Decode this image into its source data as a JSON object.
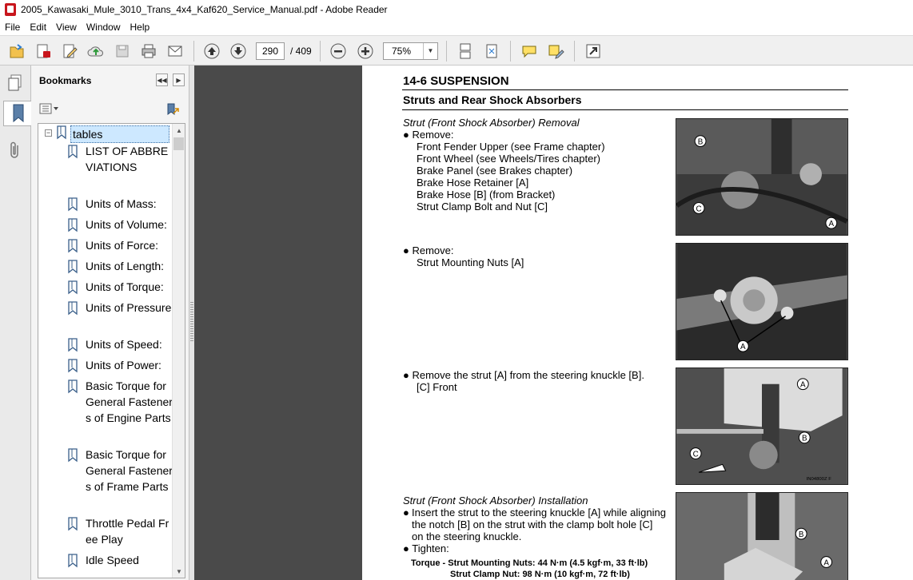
{
  "window": {
    "title": "2005_Kawasaki_Mule_3010_Trans_4x4_Kaf620_Service_Manual.pdf - Adobe Reader"
  },
  "menu": [
    "File",
    "Edit",
    "View",
    "Window",
    "Help"
  ],
  "toolbar": {
    "page_current": "290",
    "page_total": "/ 409",
    "zoom": "75%"
  },
  "bookmarks": {
    "title": "Bookmarks",
    "root": "tables",
    "items": [
      "LIST OF ABBREVIATIONS",
      "Units of Mass:",
      "Units of Volume:",
      "Units of Force:",
      "Units of Length:",
      "Units of Torque:",
      "Units of Pressure:",
      "Units of Speed:",
      "Units of Power:",
      "Basic Torque for General Fasteners of Engine Parts",
      "Basic Torque for General Fasteners of Frame Parts",
      "Throttle Pedal Free Play",
      "Idle Speed"
    ]
  },
  "page": {
    "section": "14-6 SUSPENSION",
    "subtitle": "Struts and Rear Shock Absorbers",
    "removal_heading": "Strut (Front Shock Absorber) Removal",
    "step1_bullet": "Remove:",
    "step1_items": [
      "Front Fender Upper (see Frame chapter)",
      "Front Wheel (see Wheels/Tires chapter)",
      "Brake Panel (see Brakes chapter)",
      "Brake Hose Retainer [A]",
      "Brake Hose [B] (from Bracket)",
      "Strut Clamp Bolt and Nut [C]"
    ],
    "step2_bullet": "Remove:",
    "step2_items": [
      "Strut Mounting Nuts [A]"
    ],
    "step3_bullet": "Remove the strut [A] from the steering knuckle [B].",
    "step3_items": [
      "[C] Front"
    ],
    "install_heading": "Strut (Front Shock Absorber) Installation",
    "install_bullet1": "Insert the strut to the steering knuckle [A] while aligning the notch [B] on the strut with the clamp bolt hole [C] on the steering knuckle.",
    "install_bullet2": "Tighten:",
    "torque_line1": "Torque - Strut Mounting Nuts: 44 N·m (4.5 kgf·m, 33 ft·lb)",
    "torque_line2": "Strut Clamp Nut: 98 N·m (10 kgf·m, 72 ft·lb)",
    "bullet_char": "●",
    "photo1_labels": [
      "B",
      "C",
      "A"
    ],
    "photo2_labels": [
      "A"
    ],
    "photo3_labels": [
      "A",
      "B",
      "C"
    ],
    "photo3_code": "IN04800Z F",
    "photo4_labels": [
      "B",
      "A"
    ]
  }
}
